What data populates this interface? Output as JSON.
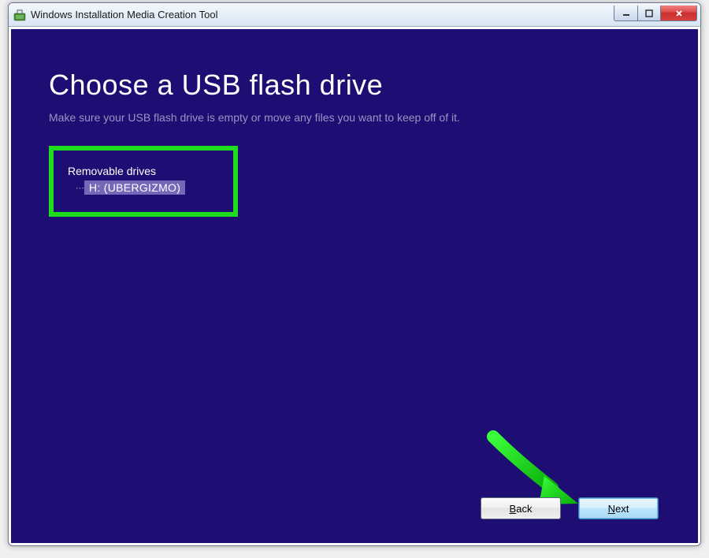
{
  "window": {
    "title": "Windows Installation Media Creation Tool"
  },
  "main": {
    "heading": "Choose a USB flash drive",
    "subtitle": "Make sure your USB flash drive is empty or move any files you want to keep off of it."
  },
  "drives": {
    "group_label": "Removable drives",
    "items": [
      {
        "label": "H: (UBERGIZMO)"
      }
    ]
  },
  "buttons": {
    "back": "Back",
    "next": "Next"
  }
}
